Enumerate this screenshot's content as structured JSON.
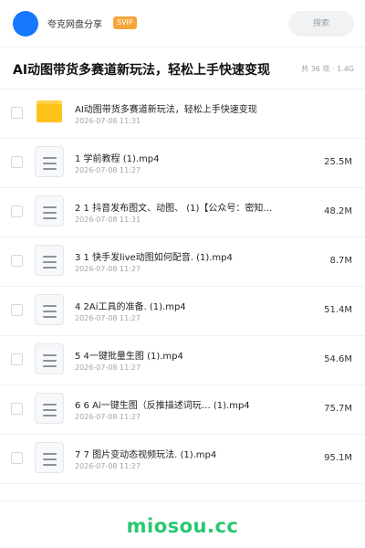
{
  "header": {
    "app_name": "夸克网盘分享",
    "badge": "SVIP",
    "search_placeholder": "搜索"
  },
  "folder": {
    "title": "AI动图带货多赛道新玩法，轻松上手快速变现",
    "meta": "共 36 项 · 1.4G"
  },
  "files": [
    {
      "type": "folder",
      "name": "AI动图带货多赛道新玩法，轻松上手快速变现",
      "date": "2026-07-08 11:31",
      "size": ""
    },
    {
      "type": "file",
      "name": "1 学前教程 (1).mp4",
      "date": "2026-07-08 11:27",
      "size": "25.5M"
    },
    {
      "type": "file",
      "name": "2 1 抖音发布图文、动图、 (1)【公众号：密知…",
      "date": "2026-07-08 11:31",
      "size": "48.2M"
    },
    {
      "type": "file",
      "name": "3 1 快手发live动图如何配音. (1).mp4",
      "date": "2026-07-08 11:27",
      "size": "8.7M"
    },
    {
      "type": "file",
      "name": "4 2Ai工具的准备. (1).mp4",
      "date": "2026-07-08 11:27",
      "size": "51.4M"
    },
    {
      "type": "file",
      "name": "5 4一键批量生图 (1).mp4",
      "date": "2026-07-08 11:27",
      "size": "54.6M"
    },
    {
      "type": "file",
      "name": "6 6 Ai一键生图（反推描述词玩… (1).mp4",
      "date": "2026-07-08 11:27",
      "size": "75.7M"
    },
    {
      "type": "file",
      "name": "7 7 图片变动态视频玩法. (1).mp4",
      "date": "2026-07-08 11:27",
      "size": "95.1M"
    }
  ],
  "watermark": "miosou.cc",
  "colors": {
    "accent": "#1677ff",
    "badge": "#f7a43b",
    "folder": "#ffc21a",
    "watermark": "#28c76f"
  },
  "icons": {
    "folder": "folder-icon",
    "file": "document-icon"
  }
}
